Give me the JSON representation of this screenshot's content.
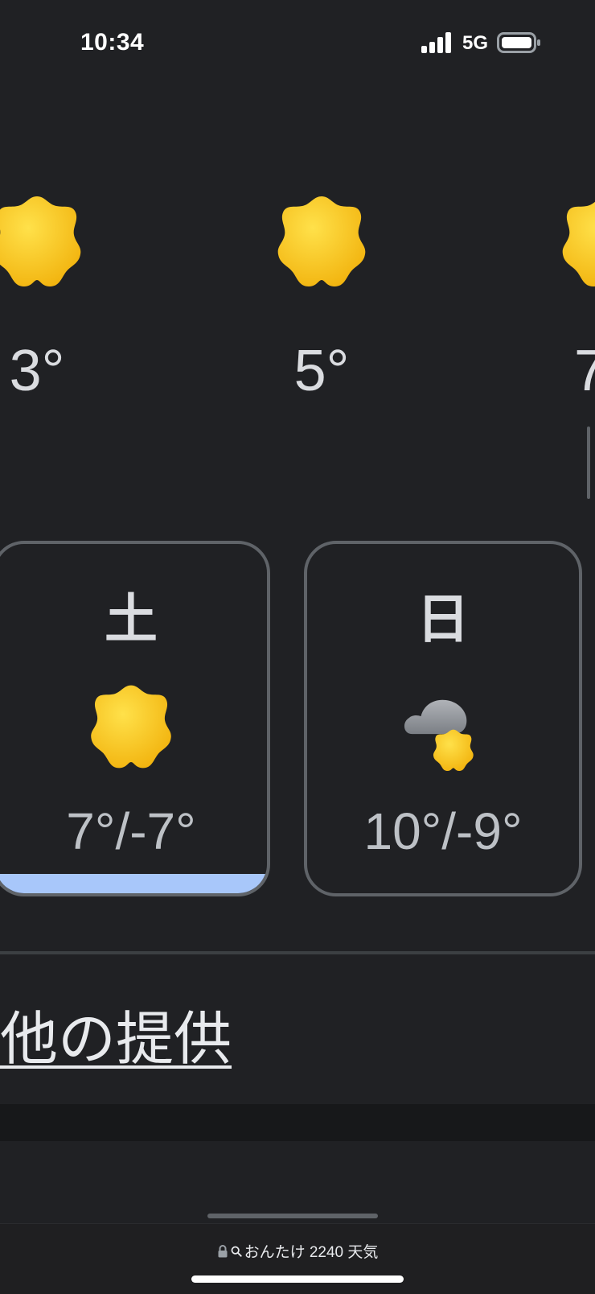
{
  "status_bar": {
    "time": "10:34",
    "network": "5G"
  },
  "hourly": [
    {
      "temp": "3°",
      "icon": "sunny-icon"
    },
    {
      "temp": "5°",
      "icon": "sunny-icon"
    },
    {
      "temp": "7",
      "icon": "sunny-icon"
    }
  ],
  "daily": [
    {
      "day": "土",
      "temp": "7°/-7°",
      "icon": "sunny-icon",
      "selected": true
    },
    {
      "day": "日",
      "temp": "10°/-9°",
      "icon": "partly-cloudy-icon",
      "selected": false
    }
  ],
  "provider": {
    "label": "他の提供"
  },
  "address_bar": {
    "query": "おんたけ 2240 天気"
  },
  "colors": {
    "background": "#202124",
    "sun": "#f9c41c",
    "selected_bar": "#a8c7fa",
    "card_border": "#5f6368"
  }
}
